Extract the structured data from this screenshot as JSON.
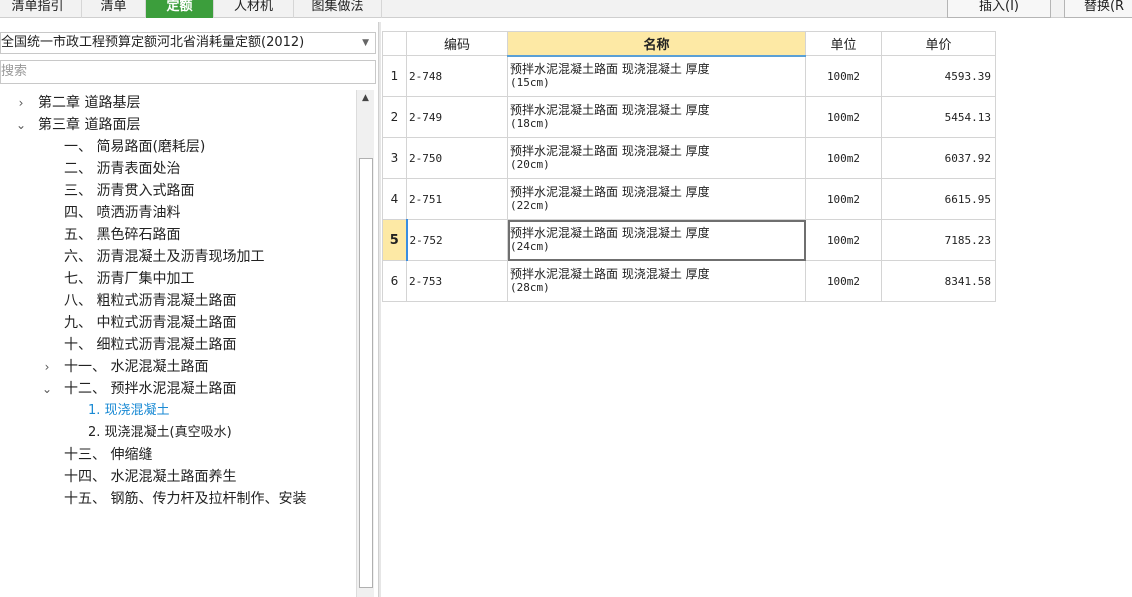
{
  "tabs": [
    {
      "label": "清单指引",
      "active": false
    },
    {
      "label": "清单",
      "active": false
    },
    {
      "label": "定额",
      "active": true
    },
    {
      "label": "人材机",
      "active": false
    },
    {
      "label": "图集做法",
      "active": false
    }
  ],
  "toolbar": {
    "insert_label": "插入(I)",
    "replace_label": "替换(R"
  },
  "left": {
    "library_selected": "全国统一市政工程预算定额河北省消耗量定额(2012)",
    "search_placeholder": "搜索",
    "tree": [
      {
        "label": "第二章  道路基层",
        "toggle": "›",
        "level": 0
      },
      {
        "label": "第三章  道路面层",
        "toggle": "⌄",
        "level": 0
      },
      {
        "label": "一、  简易路面(磨耗层)",
        "toggle": "",
        "level": 1
      },
      {
        "label": "二、  沥青表面处治",
        "toggle": "",
        "level": 1
      },
      {
        "label": "三、  沥青贯入式路面",
        "toggle": "",
        "level": 1
      },
      {
        "label": "四、  喷洒沥青油料",
        "toggle": "",
        "level": 1
      },
      {
        "label": "五、  黑色碎石路面",
        "toggle": "",
        "level": 1
      },
      {
        "label": "六、  沥青混凝土及沥青现场加工",
        "toggle": "",
        "level": 1
      },
      {
        "label": "七、  沥青厂集中加工",
        "toggle": "",
        "level": 1
      },
      {
        "label": "八、  粗粒式沥青混凝土路面",
        "toggle": "",
        "level": 1
      },
      {
        "label": "九、  中粒式沥青混凝土路面",
        "toggle": "",
        "level": 1
      },
      {
        "label": "十、  细粒式沥青混凝土路面",
        "toggle": "",
        "level": 1
      },
      {
        "label": "十一、  水泥混凝土路面",
        "toggle": "›",
        "level": 1
      },
      {
        "label": "十二、  预拌水泥混凝土路面",
        "toggle": "⌄",
        "level": 1
      },
      {
        "label": "1.  现浇混凝土",
        "toggle": "",
        "level": 2,
        "selected": true
      },
      {
        "label": "2.  现浇混凝土(真空吸水)",
        "toggle": "",
        "level": 2
      },
      {
        "label": "十三、  伸缩缝",
        "toggle": "",
        "level": 1
      },
      {
        "label": "十四、  水泥混凝土路面养生",
        "toggle": "",
        "level": 1
      },
      {
        "label": "十五、  钢筋、传力杆及拉杆制作、安装",
        "toggle": "",
        "level": 1
      }
    ]
  },
  "grid": {
    "headers": {
      "code": "编码",
      "name": "名称",
      "unit": "单位",
      "price": "单价"
    },
    "rows": [
      {
        "num": "1",
        "code": "2-748",
        "name1": "预拌水泥混凝土路面 现浇混凝土 厚度",
        "name2": "(15cm)",
        "unit": "100m2",
        "price": "4593.39"
      },
      {
        "num": "2",
        "code": "2-749",
        "name1": "预拌水泥混凝土路面 现浇混凝土 厚度",
        "name2": "(18cm)",
        "unit": "100m2",
        "price": "5454.13"
      },
      {
        "num": "3",
        "code": "2-750",
        "name1": "预拌水泥混凝土路面 现浇混凝土 厚度",
        "name2": "(20cm)",
        "unit": "100m2",
        "price": "6037.92"
      },
      {
        "num": "4",
        "code": "2-751",
        "name1": "预拌水泥混凝土路面 现浇混凝土 厚度",
        "name2": "(22cm)",
        "unit": "100m2",
        "price": "6615.95"
      },
      {
        "num": "5",
        "code": "2-752",
        "name1": "预拌水泥混凝土路面 现浇混凝土 厚度",
        "name2": "(24cm)",
        "unit": "100m2",
        "price": "7185.23",
        "current": true
      },
      {
        "num": "6",
        "code": "2-753",
        "name1": "预拌水泥混凝土路面 现浇混凝土 厚度",
        "name2": "(28cm)",
        "unit": "100m2",
        "price": "8341.58"
      }
    ]
  },
  "icons": {
    "scroll_up": "arrow-up-icon",
    "dropdown": "chevron-down-icon"
  }
}
